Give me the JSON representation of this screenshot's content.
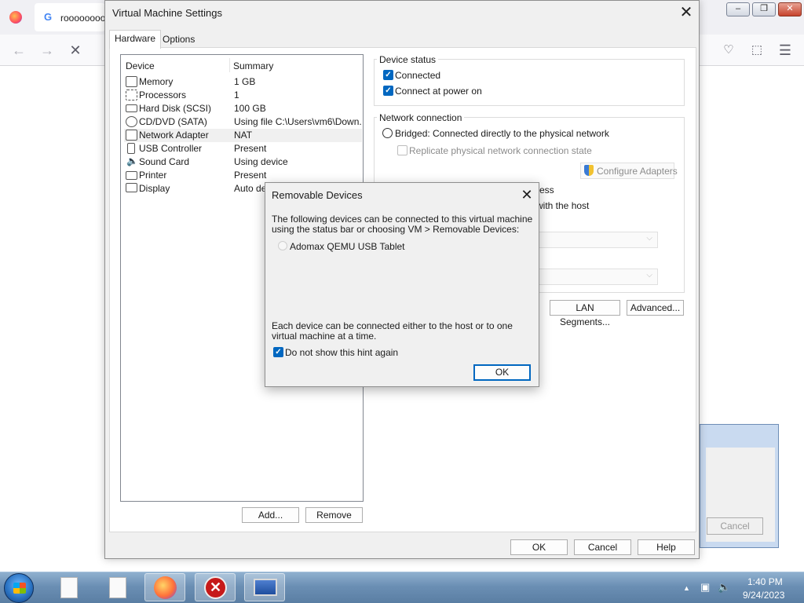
{
  "browser": {
    "tab_title": "rooooooooc",
    "window_controls": {
      "minimize": "–",
      "maximize": "❐",
      "close": "✕"
    }
  },
  "vm_settings": {
    "title": "Virtual Machine Settings",
    "tabs": [
      {
        "label": "Hardware",
        "active": true
      },
      {
        "label": "Options",
        "active": false
      }
    ],
    "device_list": {
      "col_device": "Device",
      "col_summary": "Summary",
      "rows": [
        {
          "device": "Memory",
          "summary": "1 GB",
          "icon": "memory-icon"
        },
        {
          "device": "Processors",
          "summary": "1",
          "icon": "processor-icon"
        },
        {
          "device": "Hard Disk (SCSI)",
          "summary": "100 GB",
          "icon": "hard-disk-icon"
        },
        {
          "device": "CD/DVD (SATA)",
          "summary": "Using file C:\\Users\\vm6\\Down...",
          "icon": "cd-dvd-icon"
        },
        {
          "device": "Network Adapter",
          "summary": "NAT",
          "icon": "network-adapter-icon",
          "selected": true
        },
        {
          "device": "USB Controller",
          "summary": "Present",
          "icon": "usb-icon"
        },
        {
          "device": "Sound Card",
          "summary": "Using device",
          "icon": "speaker-icon"
        },
        {
          "device": "Printer",
          "summary": "Present",
          "icon": "printer-icon"
        },
        {
          "device": "Display",
          "summary": "Auto de",
          "icon": "display-icon"
        }
      ]
    },
    "add_button": "Add...",
    "remove_button": "Remove",
    "device_status": {
      "title": "Device status",
      "connected": "Connected",
      "connect_at_power_on": "Connect at power on"
    },
    "network_connection": {
      "title": "Network connection",
      "bridged": "Bridged: Connected directly to the physical network",
      "replicate": "Replicate physical network connection state",
      "configure_adapters": "Configure Adapters",
      "partial_text_1": "ess",
      "partial_text_2": "with the host"
    },
    "lan_segments_button": "LAN Segments...",
    "advanced_button": "Advanced...",
    "ok_button": "OK",
    "cancel_button": "Cancel",
    "help_button": "Help"
  },
  "removable_devices": {
    "title": "Removable Devices",
    "description": "The following devices can be connected to this virtual machine using the status bar or choosing VM > Removable Devices:",
    "device": "Adomax QEMU USB Tablet",
    "note": "Each device can be connected either to the host or to one virtual machine at a time.",
    "hint_checkbox": "Do not show this hint again",
    "ok_button": "OK"
  },
  "background_window": {
    "cancel_button": "Cancel"
  },
  "taskbar": {
    "time": "1:40 PM",
    "date": "9/24/2023"
  },
  "colors": {
    "accent": "#0067c0",
    "dialog_bg": "#f0f0f0",
    "taskbar": "#6b8fb4"
  }
}
